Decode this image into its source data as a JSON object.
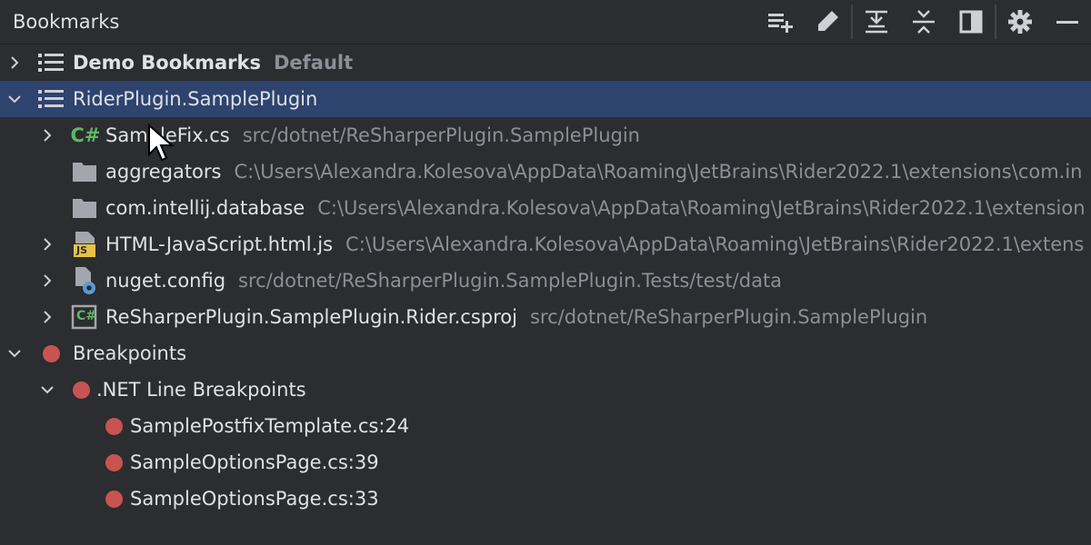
{
  "header": {
    "title": "Bookmarks",
    "actions": [
      "add-list-icon",
      "edit-icon",
      "expand-all-icon",
      "collapse-all-icon",
      "preview-pane-icon",
      "gear-icon",
      "minimize-icon"
    ]
  },
  "tree": [
    {
      "label": "Demo Bookmarks",
      "secondary": "Default",
      "icon": "list-icon",
      "expanded": false,
      "bold": true
    },
    {
      "label": "RiderPlugin.SamplePlugin",
      "icon": "list-icon",
      "expanded": true,
      "selected": true
    },
    {
      "label": "SampleFix.cs",
      "secondary": "src/dotnet/ReSharperPlugin.SamplePlugin",
      "icon": "csharp-file-icon",
      "expanded": false
    },
    {
      "label": "aggregators",
      "secondary": "C:\\Users\\Alexandra.Kolesova\\AppData\\Roaming\\JetBrains\\Rider2022.1\\extensions\\com.in",
      "icon": "folder-icon"
    },
    {
      "label": "com.intellij.database",
      "secondary": "C:\\Users\\Alexandra.Kolesova\\AppData\\Roaming\\JetBrains\\Rider2022.1\\extension",
      "icon": "folder-icon"
    },
    {
      "label": "HTML-JavaScript.html.js",
      "secondary": "C:\\Users\\Alexandra.Kolesova\\AppData\\Roaming\\JetBrains\\Rider2022.1\\extens",
      "icon": "javascript-file-icon",
      "expanded": false
    },
    {
      "label": "nuget.config",
      "secondary": "src/dotnet/ReSharperPlugin.SamplePlugin.Tests/test/data",
      "icon": "config-file-icon",
      "expanded": false
    },
    {
      "label": "ReSharperPlugin.SamplePlugin.Rider.csproj",
      "secondary": "src/dotnet/ReSharperPlugin.SamplePlugin",
      "icon": "csproj-file-icon",
      "expanded": false
    },
    {
      "label": "Breakpoints",
      "icon": "breakpoint-icon",
      "expanded": true
    },
    {
      "label": ".NET Line Breakpoints",
      "icon": "breakpoint-icon",
      "expanded": true
    },
    {
      "label": "SamplePostfixTemplate.cs:24",
      "icon": "breakpoint-icon"
    },
    {
      "label": "SampleOptionsPage.cs:39",
      "icon": "breakpoint-icon"
    },
    {
      "label": "SampleOptionsPage.cs:33",
      "icon": "breakpoint-icon"
    }
  ],
  "icon_text": {
    "csharp": "C#",
    "js": "JS"
  },
  "colors": {
    "background": "#2b2d30",
    "selection": "#2e436e",
    "text": "#dfe1e5",
    "secondary_text": "#8c8f96",
    "breakpoint": "#c75450",
    "csharp": "#5fb85f",
    "javascript": "#e8c246"
  }
}
